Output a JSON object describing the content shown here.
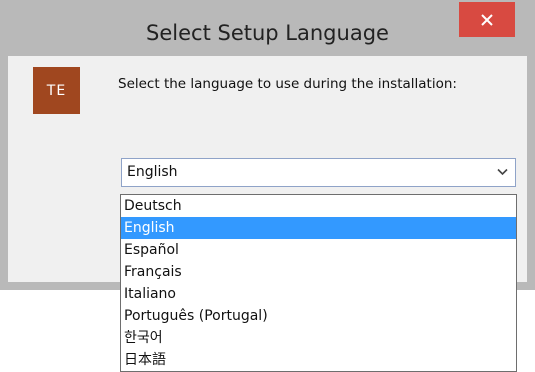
{
  "window": {
    "title": "Select Setup Language",
    "close_icon": "close-icon",
    "accent_close": "#d84a41"
  },
  "app_icon": {
    "text": "TE",
    "color": "#a0471f"
  },
  "prompt": "Select the language to use during the installation:",
  "combo": {
    "value": "English",
    "arrow_icon": "chevron-down-icon"
  },
  "list": {
    "selected_index": 1,
    "selected_color": "#3399ff",
    "items": [
      "Deutsch",
      "English",
      "Español",
      "Français",
      "Italiano",
      "Português (Portugal)",
      "한국어",
      "日本語"
    ]
  }
}
